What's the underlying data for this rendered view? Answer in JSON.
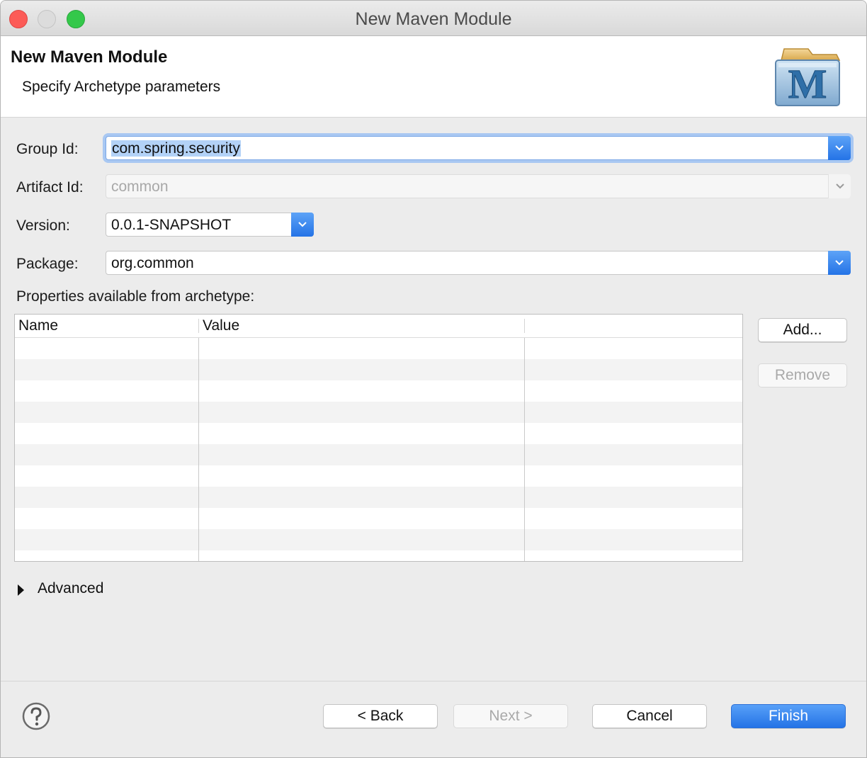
{
  "window": {
    "title": "New Maven Module"
  },
  "banner": {
    "title": "New Maven Module",
    "subtitle": "Specify Archetype parameters",
    "logo_letter": "M"
  },
  "form": {
    "group_id": {
      "label": "Group Id:",
      "value": "com.spring.security"
    },
    "artifact_id": {
      "label": "Artifact Id:",
      "value": "common"
    },
    "version": {
      "label": "Version:",
      "value": "0.0.1-SNAPSHOT"
    },
    "package": {
      "label": "Package:",
      "value": "org.common"
    }
  },
  "properties": {
    "label": "Properties available from archetype:",
    "columns": [
      "Name",
      "Value",
      ""
    ],
    "rows": [],
    "add_label": "Add...",
    "remove_label": "Remove"
  },
  "advanced": {
    "label": "Advanced"
  },
  "footer": {
    "back_label": "< Back",
    "next_label": "Next >",
    "cancel_label": "Cancel",
    "finish_label": "Finish"
  },
  "colors": {
    "accent": "#2473e6",
    "selection": "#b3d2f7",
    "close": "#fc5b57",
    "maximize": "#34c84a"
  }
}
